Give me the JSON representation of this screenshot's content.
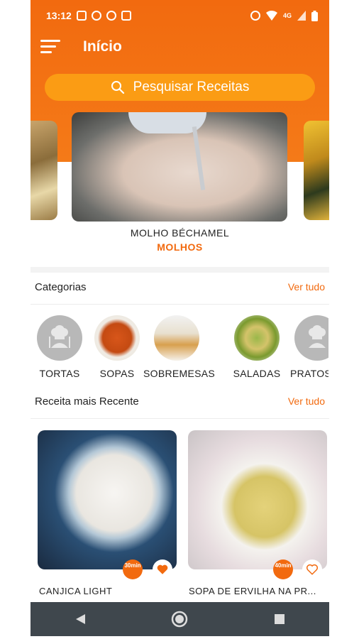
{
  "status_bar": {
    "time": "13:12",
    "network": "4G"
  },
  "app_bar": {
    "title": "Início"
  },
  "search": {
    "placeholder": "Pesquisar Receitas"
  },
  "featured": {
    "name": "MOLHO BÉCHAMEL",
    "category": "MOLHOS"
  },
  "categories": {
    "title": "Categorias",
    "see_all": "Ver tudo",
    "items": [
      {
        "label": "TORTAS",
        "icon": "chef-icon"
      },
      {
        "label": "SOPAS",
        "icon": "photo"
      },
      {
        "label": "SOBREMESAS",
        "icon": "photo"
      },
      {
        "label": "SALADAS",
        "icon": "photo"
      },
      {
        "label": "PRATOS",
        "icon": "chef-icon"
      }
    ]
  },
  "recent": {
    "title": "Receita mais Recente",
    "see_all": "Ver tudo",
    "items": [
      {
        "name": "CANJICA LIGHT",
        "time": "30min",
        "favorite": true
      },
      {
        "name": "SOPA DE ERVILHA NA PR...",
        "time": "40min",
        "favorite": false
      }
    ]
  },
  "colors": {
    "accent": "#f26a0f",
    "search_bg": "#fb9c14",
    "navbar": "#3f474d"
  }
}
